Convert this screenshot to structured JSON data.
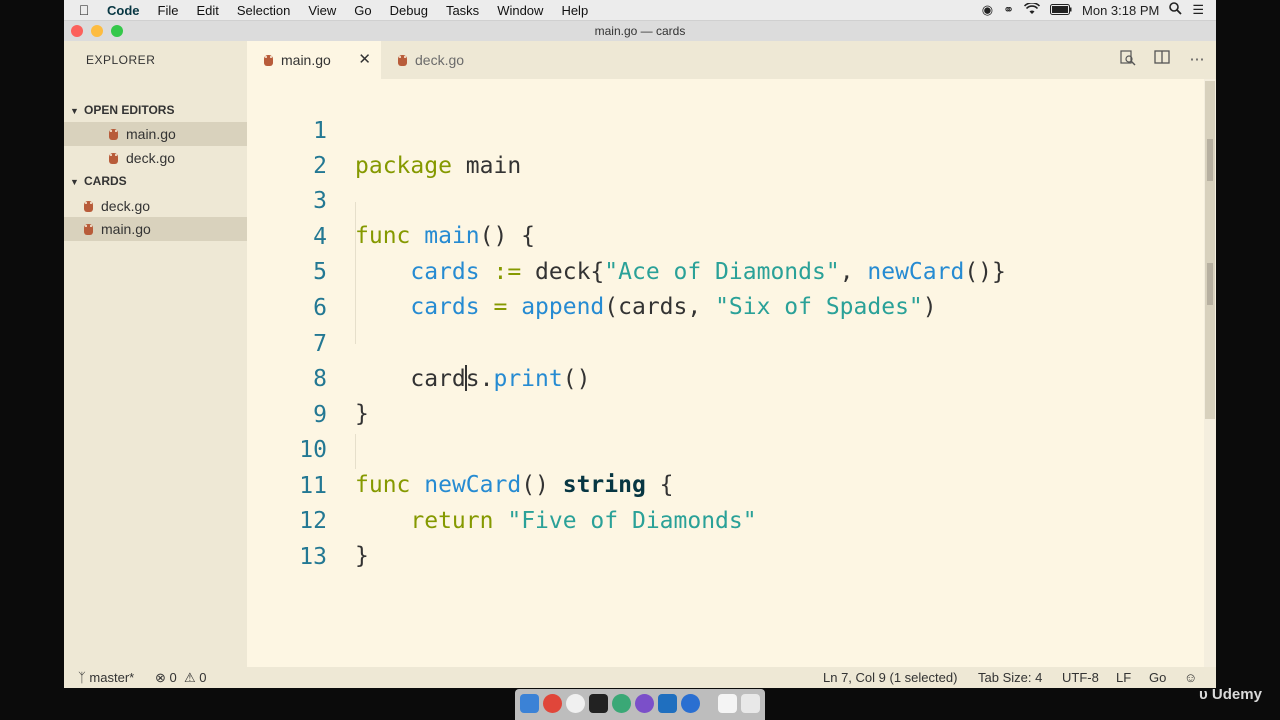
{
  "menubar": {
    "app_name": "Code",
    "items": [
      "File",
      "Edit",
      "Selection",
      "View",
      "Go",
      "Debug",
      "Tasks",
      "Window",
      "Help"
    ],
    "clock": "Mon 3:18 PM"
  },
  "window": {
    "title": "main.go — cards"
  },
  "sidebar": {
    "header": "EXPLORER",
    "open_editors_label": "OPEN EDITORS",
    "open_editors": [
      "main.go",
      "deck.go"
    ],
    "folder_label": "CARDS",
    "files": [
      "deck.go",
      "main.go"
    ]
  },
  "tabs": [
    {
      "label": "main.go",
      "active": true
    },
    {
      "label": "deck.go",
      "active": false
    }
  ],
  "editor": {
    "line_numbers": [
      "1",
      "2",
      "3",
      "4",
      "5",
      "6",
      "7",
      "8",
      "9",
      "10",
      "11",
      "12",
      "13"
    ],
    "lines": {
      "l1": {
        "kw": "package",
        "rest": " main"
      },
      "l3": {
        "kw": "func",
        "fn": "main",
        "rest": "() {"
      },
      "l4": {
        "var": "cards",
        "op": " := ",
        "plain": "deck{",
        "str": "\"Ace of Diamonds\"",
        "sep": ", ",
        "fn": "newCard",
        "end": "()}"
      },
      "l5": {
        "var": "cards",
        "op": " = ",
        "fn": "append",
        "plain": "(cards, ",
        "str": "\"Six of Spades\"",
        "end": ")"
      },
      "l7": {
        "pre": "card",
        "post": "s.",
        "fn": "print",
        "end": "()"
      },
      "l8": {
        "text": "}"
      },
      "l10": {
        "kw": "func",
        "fn": "newCard",
        "mid": "() ",
        "type": "string",
        "end": " {"
      },
      "l11": {
        "kw": "return",
        "str": "\"Five of Diamonds\""
      },
      "l12": {
        "text": "}"
      }
    }
  },
  "statusbar": {
    "branch": "master*",
    "errors": "0",
    "warnings": "0",
    "position": "Ln 7, Col 9 (1 selected)",
    "tab_size": "Tab Size: 4",
    "encoding": "UTF-8",
    "eol": "LF",
    "language": "Go"
  },
  "watermark": "Udemy"
}
